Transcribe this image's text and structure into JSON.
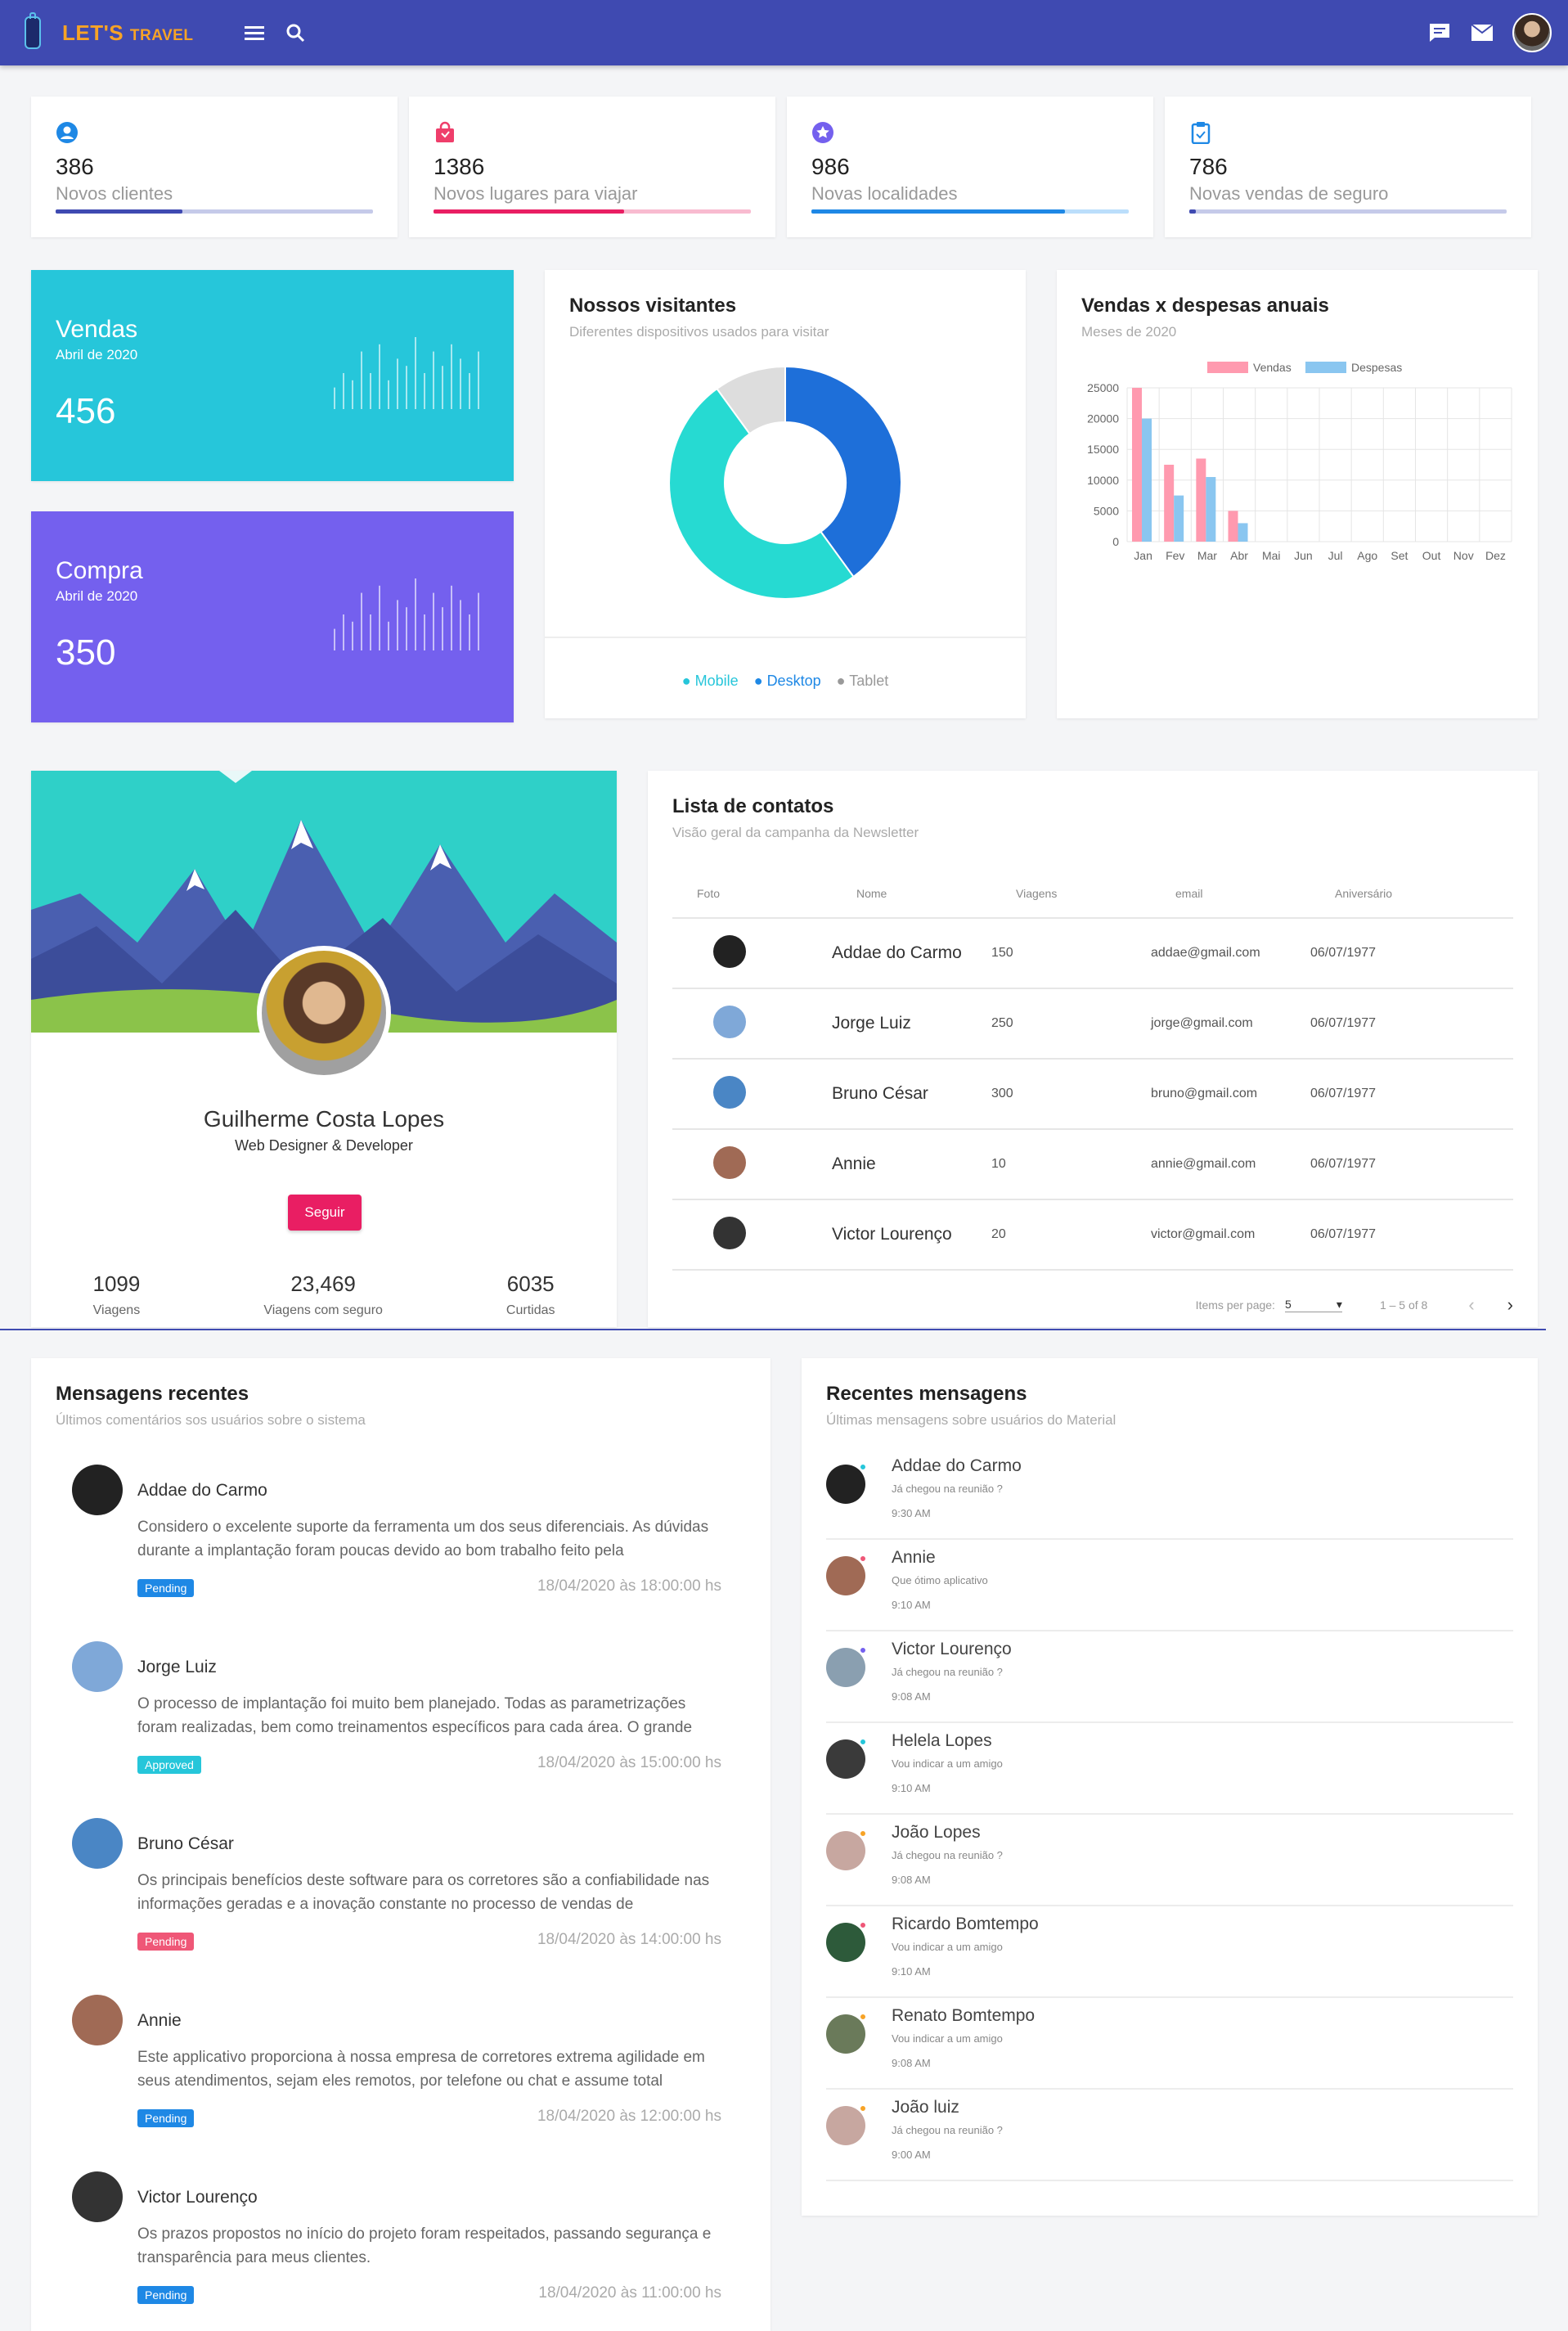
{
  "app": {
    "brand_main": "LET'S",
    "brand_sub": "TRAVEL"
  },
  "stats": [
    {
      "value": "386",
      "label": "Novos clientes",
      "color": "#3f4ab1",
      "track": "#c5cae9",
      "progress": 0.4,
      "icon": "account-circle-icon"
    },
    {
      "value": "1386",
      "label": "Novos lugares para viajar",
      "color": "#e91e63",
      "track": "#f8bbd0",
      "progress": 0.6,
      "icon": "shopping-bag-icon"
    },
    {
      "value": "986",
      "label": "Novas localidades",
      "color": "#1e88e5",
      "track": "#bbdefb",
      "progress": 0.8,
      "icon": "star-badge-icon"
    },
    {
      "value": "786",
      "label": "Novas vendas de seguro",
      "color": "#3f4ab1",
      "track": "#c5cae9",
      "progress": 0.02,
      "icon": "clipboard-icon"
    }
  ],
  "kpis": [
    {
      "title": "Vendas",
      "subtitle": "Abril de 2020",
      "value": "456",
      "color": "#26c6da"
    },
    {
      "title": "Compra",
      "subtitle": "Abril de 2020",
      "value": "350",
      "color": "#7460ee"
    }
  ],
  "visitors": {
    "title": "Nossos visitantes",
    "subtitle": "Diferentes dispositivos usados para visitar",
    "legend": [
      "Mobile",
      "Desktop",
      "Tablet"
    ],
    "legend_colors": [
      "#26c6da",
      "#1e88e5",
      "#999999"
    ],
    "chart_data": {
      "type": "pie",
      "series": [
        {
          "name": "Mobile",
          "value": 50,
          "color": "#26dad2"
        },
        {
          "name": "Desktop",
          "value": 40,
          "color": "#1e6fd9"
        },
        {
          "name": "Tablet",
          "value": 10,
          "color": "#dddddd"
        }
      ]
    }
  },
  "annual": {
    "title": "Vendas x despesas anuais",
    "subtitle": "Meses de 2020",
    "chart_data": {
      "type": "bar",
      "categories": [
        "Jan",
        "Fev",
        "Mar",
        "Abr",
        "Mai",
        "Jun",
        "Jul",
        "Ago",
        "Set",
        "Out",
        "Nov",
        "Dez"
      ],
      "series": [
        {
          "name": "Vendas",
          "values": [
            25000,
            12500,
            13500,
            5000,
            0,
            0,
            0,
            0,
            0,
            0,
            0,
            0
          ],
          "color": "#ff9aaf"
        },
        {
          "name": "Despesas",
          "values": [
            20000,
            7500,
            10500,
            3000,
            0,
            0,
            0,
            0,
            0,
            0,
            0,
            0
          ],
          "color": "#8ac6f0"
        }
      ],
      "yticks": [
        "25000",
        "20000",
        "15000",
        "10000",
        "5000",
        "0"
      ],
      "ylim": [
        0,
        25000
      ],
      "grid": true,
      "legend": "top"
    }
  },
  "profile": {
    "name": "Guilherme Costa Lopes",
    "role": "Web Designer & Developer",
    "follow_label": "Seguir",
    "stats": [
      {
        "value": "1099",
        "label": "Viagens"
      },
      {
        "value": "23,469",
        "label": "Viagens com seguro"
      },
      {
        "value": "6035",
        "label": "Curtidas"
      }
    ]
  },
  "contacts": {
    "title": "Lista de contatos",
    "subtitle": "Visão geral da campanha da Newsletter",
    "columns": [
      "Foto",
      "Nome",
      "Viagens",
      "email",
      "Aniversário"
    ],
    "rows": [
      {
        "name": "Addae do Carmo",
        "trips": "150",
        "email": "addae@gmail.com",
        "birthday": "06/07/1977",
        "avatar_color": "#222222"
      },
      {
        "name": "Jorge Luiz",
        "trips": "250",
        "email": "jorge@gmail.com",
        "birthday": "06/07/1977",
        "avatar_color": "#7fa8d8"
      },
      {
        "name": "Bruno César",
        "trips": "300",
        "email": "bruno@gmail.com",
        "birthday": "06/07/1977",
        "avatar_color": "#4a86c5"
      },
      {
        "name": "Annie",
        "trips": "10",
        "email": "annie@gmail.com",
        "birthday": "06/07/1977",
        "avatar_color": "#a06a55"
      },
      {
        "name": "Victor Lourenço",
        "trips": "20",
        "email": "victor@gmail.com",
        "birthday": "06/07/1977",
        "avatar_color": "#333333"
      }
    ],
    "paginator": {
      "items_per_page_label": "Items per page:",
      "page_size": "5",
      "range": "1 – 5 of 8"
    }
  },
  "recent": {
    "title": "Mensagens recentes",
    "subtitle": "Últimos comentários sos usuários sobre o sistema",
    "items": [
      {
        "name": "Addae do Carmo",
        "text": "Considero o excelente suporte da ferramenta um dos seus diferenciais. As dúvidas durante a implantação foram poucas devido ao bom trabalho feito pela",
        "badge": "Pending",
        "badge_color": "#1e88e5",
        "date": "18/04/2020 às 18:00:00 hs",
        "avatar_color": "#222222"
      },
      {
        "name": "Jorge Luiz",
        "text": "O processo de implantação foi muito bem planejado. Todas as parametrizações foram realizadas, bem como treinamentos específicos para cada área. O grande",
        "badge": "Approved",
        "badge_color": "#26c6da",
        "date": "18/04/2020 às 15:00:00 hs",
        "avatar_color": "#7fa8d8"
      },
      {
        "name": "Bruno César",
        "text": "Os principais benefícios deste software para os corretores são a confiabilidade nas informações geradas e a inovação constante no processo de vendas de",
        "badge": "Pending",
        "badge_color": "#ef5777",
        "date": "18/04/2020 às 14:00:00 hs",
        "avatar_color": "#4a86c5"
      },
      {
        "name": "Annie",
        "text": "Este applicativo proporciona à nossa empresa de corretores extrema agilidade em seus atendimentos, sejam eles remotos, por telefone ou chat e assume total",
        "badge": "Pending",
        "badge_color": "#1e88e5",
        "date": "18/04/2020 às 12:00:00 hs",
        "avatar_color": "#a06a55"
      },
      {
        "name": "Victor Lourenço",
        "text": "Os prazos propostos no início do projeto foram respeitados, passando segurança e transparência para meus clientes.",
        "badge": "Pending",
        "badge_color": "#1e88e5",
        "date": "18/04/2020 às 11:00:00 hs",
        "avatar_color": "#333333"
      }
    ]
  },
  "messages": {
    "title": "Recentes mensagens",
    "subtitle": "Últimas mensagens sobre usuários do Material",
    "items": [
      {
        "name": "Addae do Carmo",
        "text": "Já chegou na reunião ?",
        "time": "9:30 AM",
        "dot": "#26c6da",
        "avatar_color": "#222222"
      },
      {
        "name": "Annie",
        "text": "Que ótimo aplicativo",
        "time": "9:10 AM",
        "dot": "#ef5777",
        "avatar_color": "#a06a55"
      },
      {
        "name": "Victor Lourenço",
        "text": "Já chegou na reunião ?",
        "time": "9:08 AM",
        "dot": "#7460ee",
        "avatar_color": "#8a9fb0"
      },
      {
        "name": "Helela Lopes",
        "text": "Vou indicar a um amigo",
        "time": "9:10 AM",
        "dot": "#26c6da",
        "avatar_color": "#3a3a3a"
      },
      {
        "name": "João Lopes",
        "text": "Já chegou na reunião ?",
        "time": "9:08 AM",
        "dot": "#f7a326",
        "avatar_color": "#c7a7a0"
      },
      {
        "name": "Ricardo Bomtempo",
        "text": "Vou indicar a um amigo",
        "time": "9:10 AM",
        "dot": "#ef5777",
        "avatar_color": "#2d5a3a"
      },
      {
        "name": "Renato Bomtempo",
        "text": "Vou indicar a um amigo",
        "time": "9:08 AM",
        "dot": "#f7a326",
        "avatar_color": "#6a7a5a"
      },
      {
        "name": "João luiz",
        "text": "Já chegou na reunião ?",
        "time": "9:00 AM",
        "dot": "#f7a326",
        "avatar_color": "#c7a7a0"
      }
    ]
  }
}
